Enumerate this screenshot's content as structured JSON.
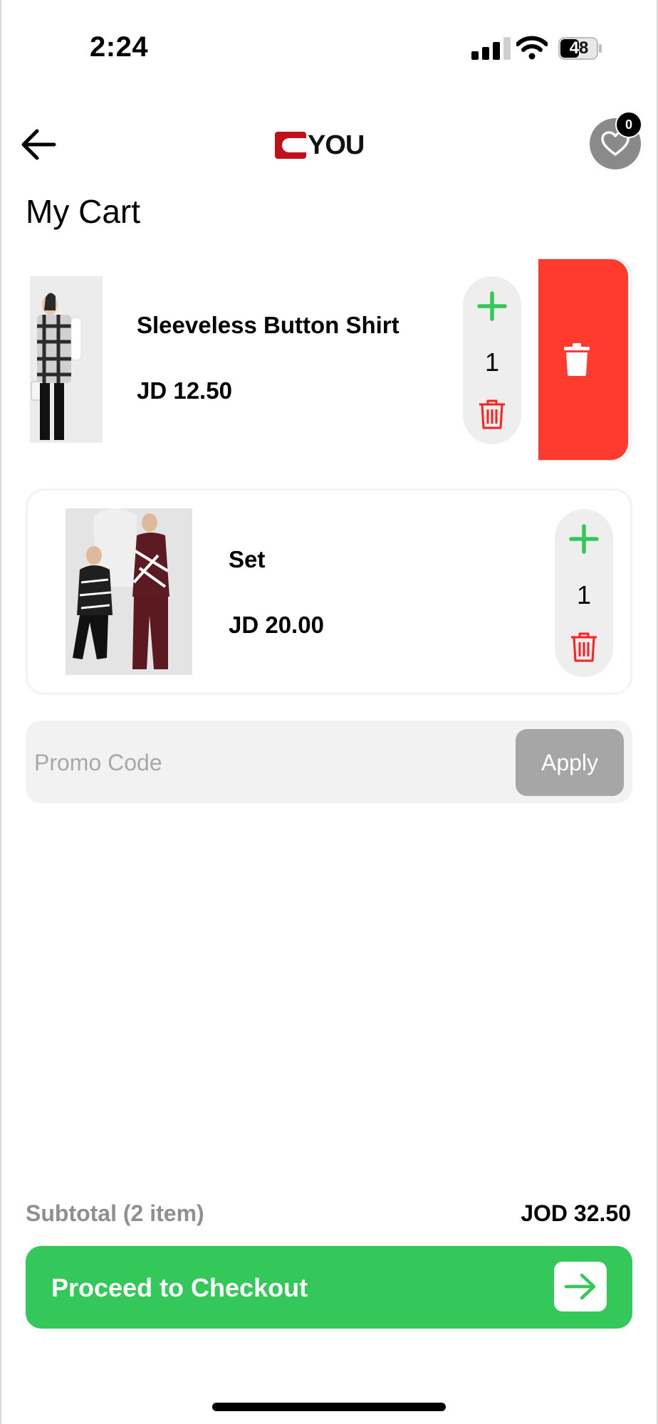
{
  "status_bar": {
    "time": "2:24",
    "battery": "48"
  },
  "header": {
    "back_icon": "arrow-left-icon",
    "logo_text": "YOU",
    "favorites_icon": "heart-icon",
    "favorites_count": "0"
  },
  "page": {
    "title": "My Cart"
  },
  "cart": {
    "items": [
      {
        "name": "Sleeveless Button Shirt",
        "price": "JD 12.50",
        "quantity": "1",
        "image": "woman-plaid-vest-photo"
      },
      {
        "name": "Set",
        "price": "JD 20.00",
        "quantity": "1",
        "image": "two-women-knit-set-photo"
      }
    ],
    "swipe_delete_icon": "trash-icon"
  },
  "promo": {
    "placeholder": "Promo Code",
    "value": "",
    "apply_label": "Apply"
  },
  "summary": {
    "subtotal_label": "Subtotal (2 item)",
    "subtotal_value": "JOD 32.50"
  },
  "checkout": {
    "label": "Proceed to Checkout",
    "icon": "arrow-right-icon"
  },
  "colors": {
    "accent_green": "#34c759",
    "delete_red": "#ff3b30",
    "brand_red": "#c0111b"
  }
}
